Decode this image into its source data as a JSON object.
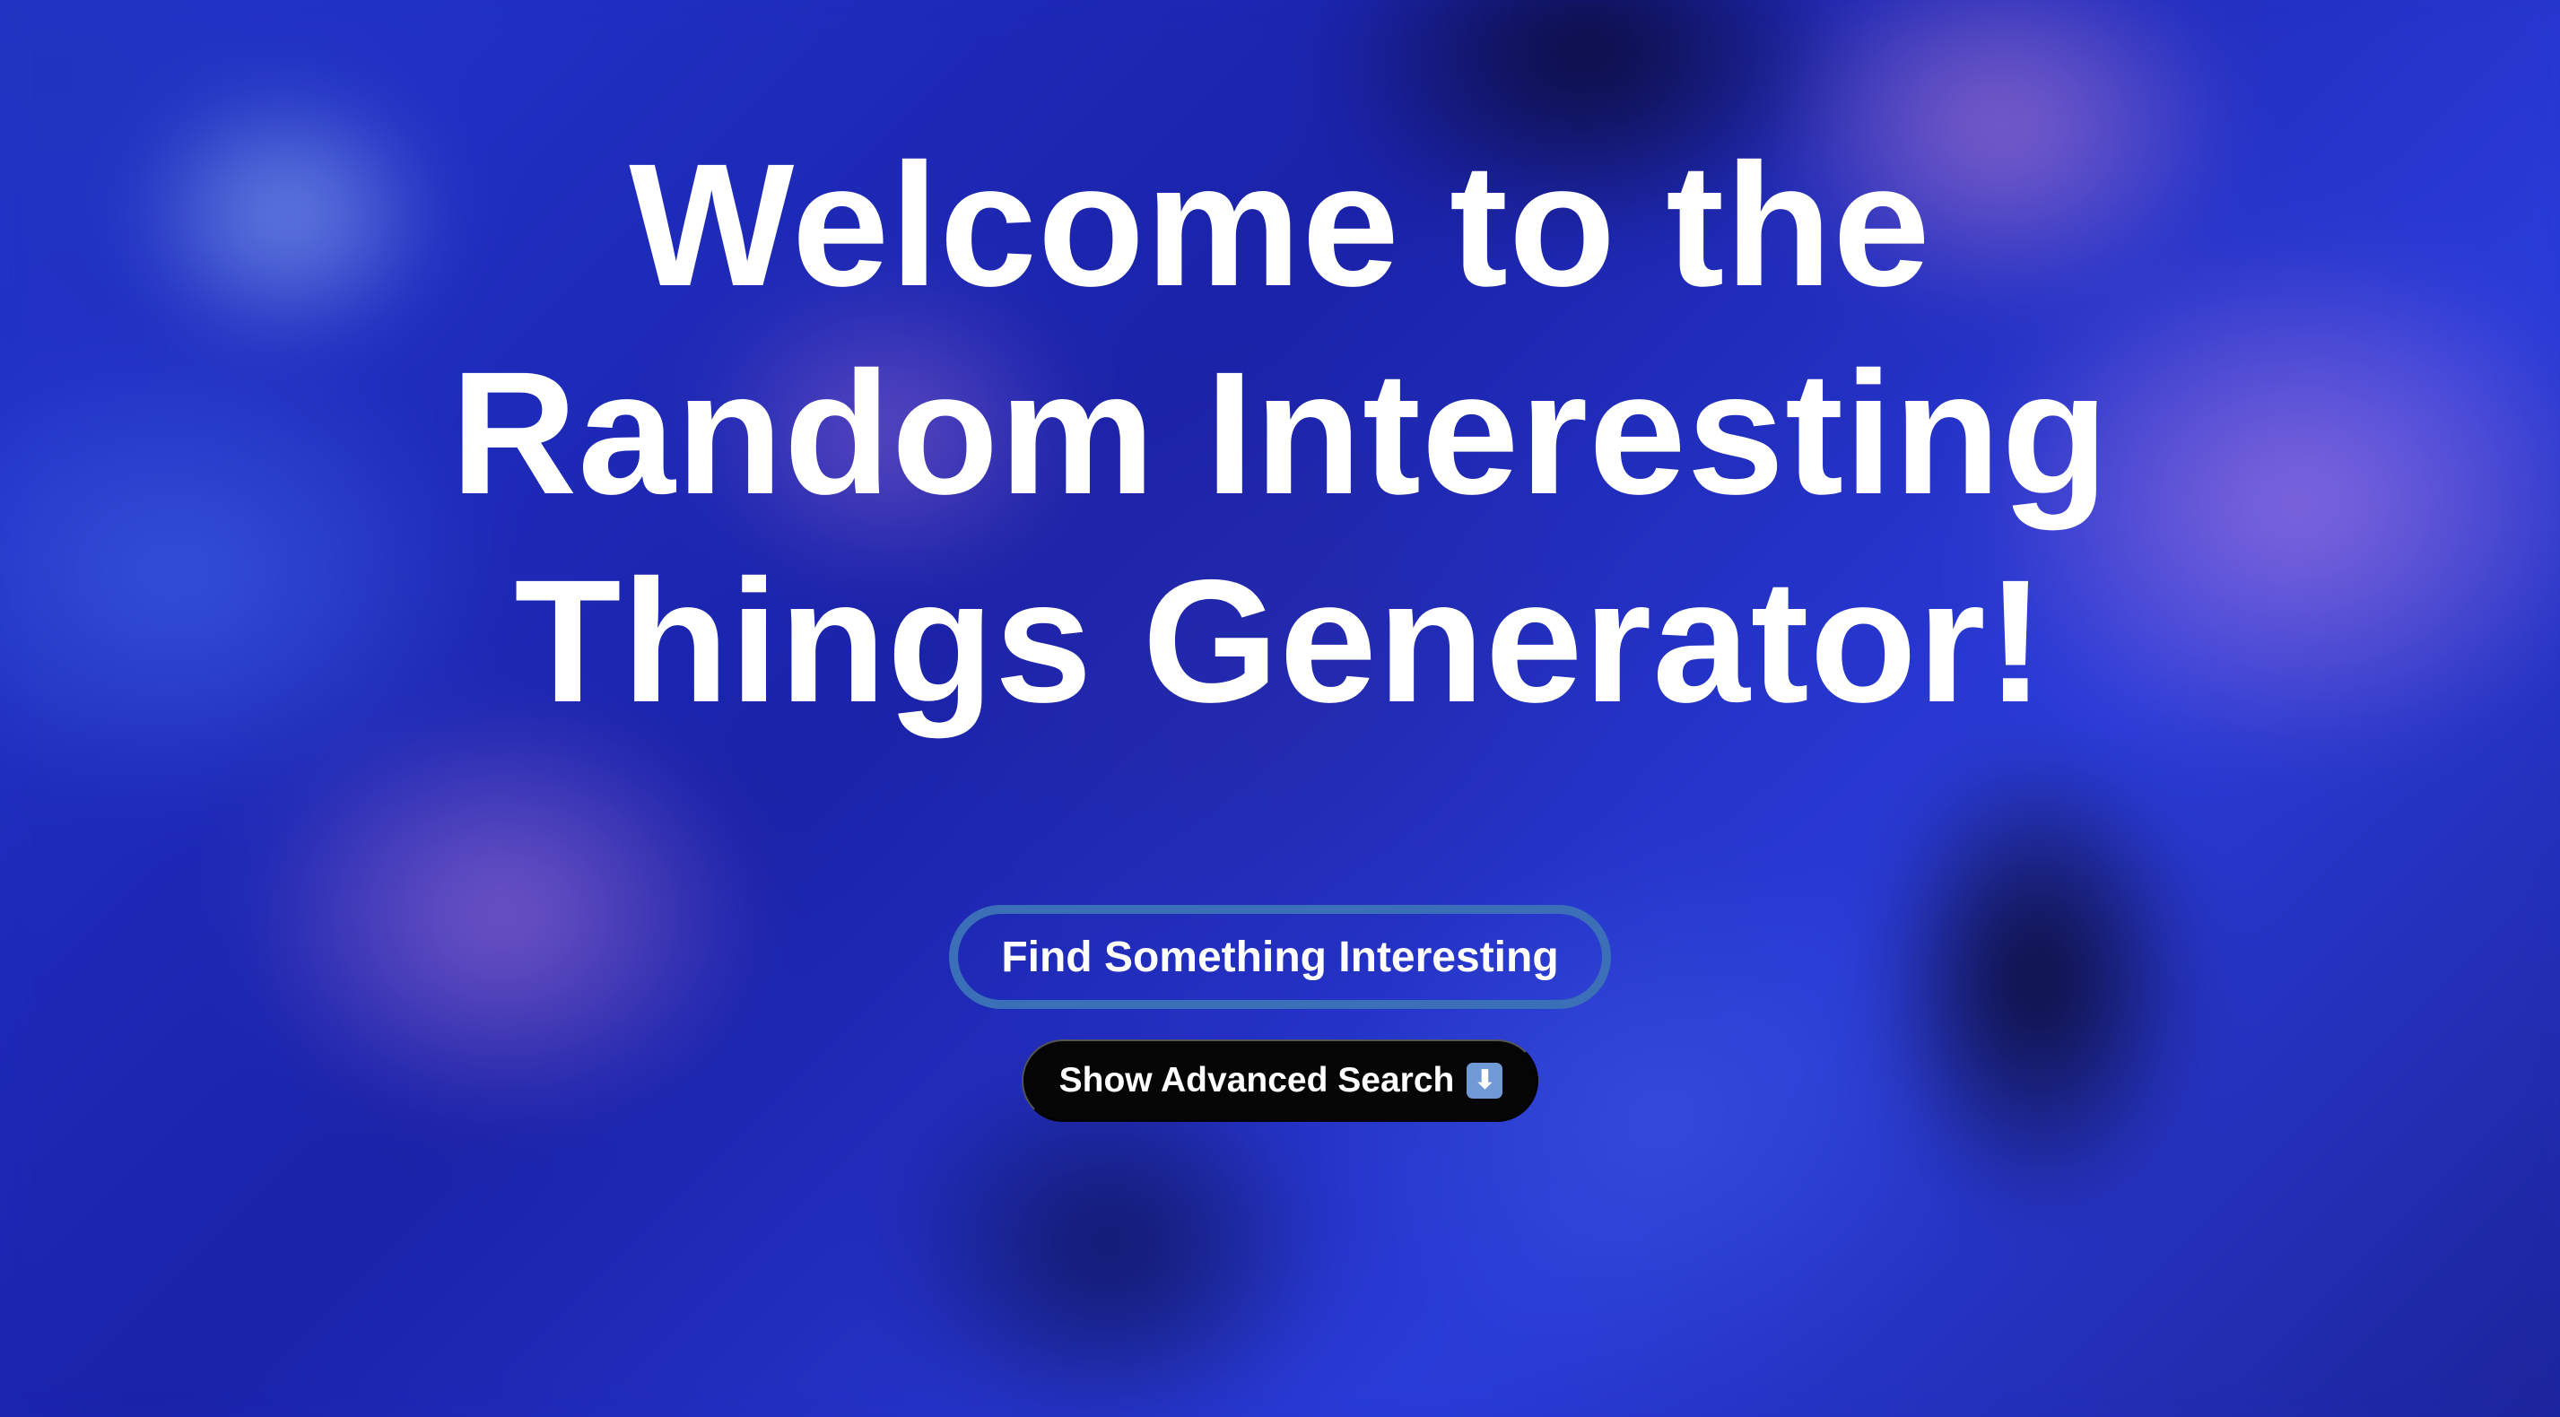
{
  "hero": {
    "title": "Welcome to the Random Interesting Things Generator!"
  },
  "actions": {
    "find_label": "Find Something Interesting",
    "advanced_label": "Show Advanced Search",
    "advanced_icon": "arrow-down-icon",
    "advanced_icon_glyph": "⬇"
  },
  "colors": {
    "background_primary": "#1f2fc4",
    "find_button_border": "#3b6fb8",
    "advanced_button_bg": "#050505",
    "text": "#ffffff"
  }
}
